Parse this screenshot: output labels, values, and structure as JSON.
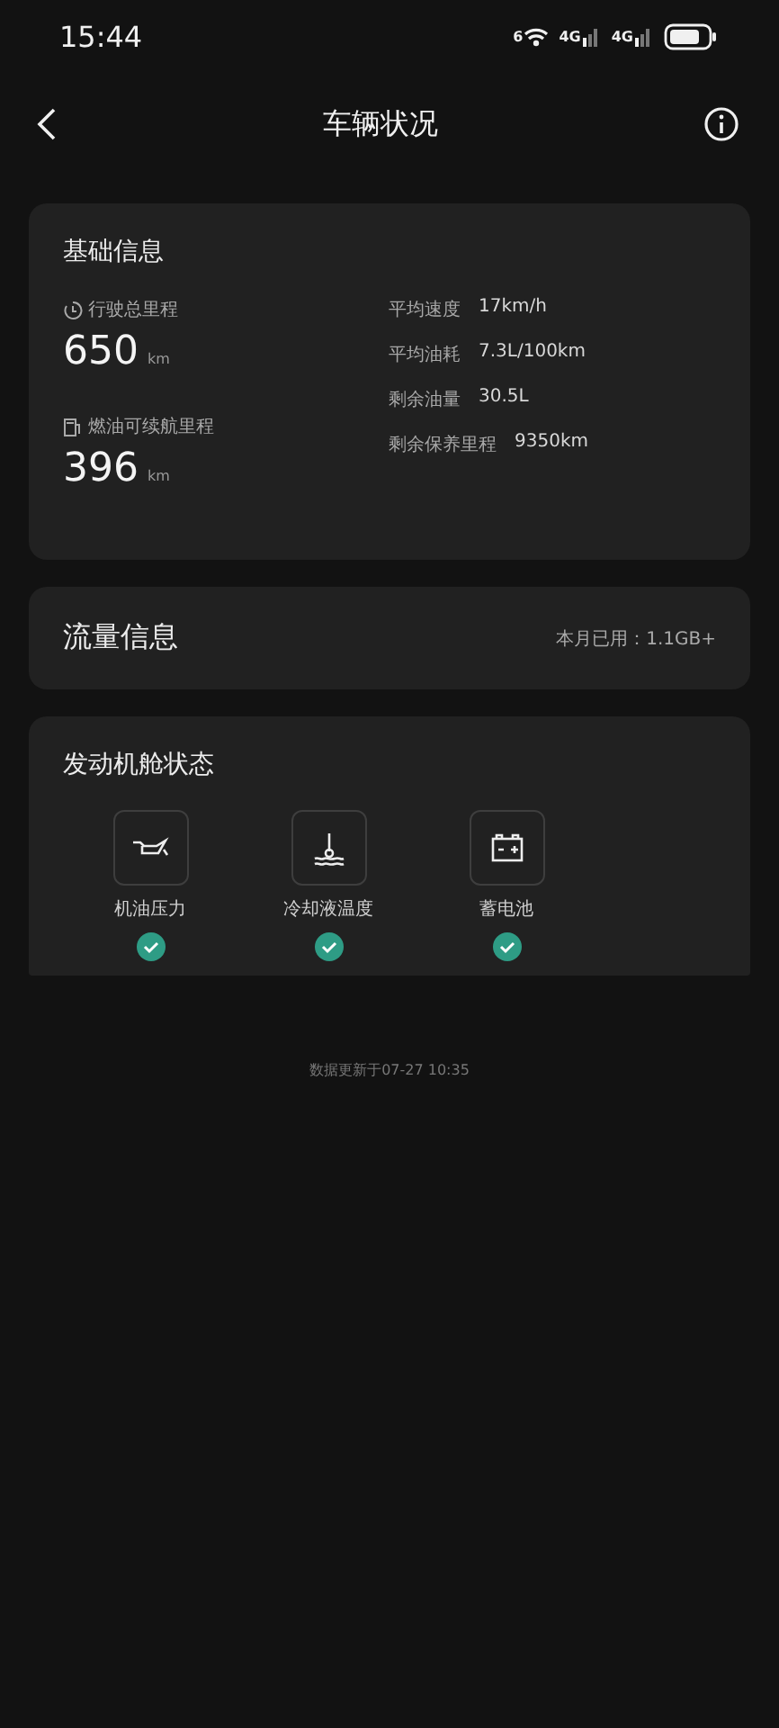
{
  "status_bar": {
    "time": "15:44",
    "wifi_badge": "6",
    "signals": [
      "4G",
      "4G"
    ]
  },
  "header": {
    "title": "车辆状况"
  },
  "basic_info": {
    "title": "基础信息",
    "big_stats": [
      {
        "kind": "clock",
        "label": "行驶总里程",
        "value": "650",
        "unit": "km"
      },
      {
        "kind": "fuel",
        "label": "燃油可续航里程",
        "value": "396",
        "unit": "km"
      }
    ],
    "details": [
      {
        "label": "平均速度",
        "value": "17km/h"
      },
      {
        "label": "平均油耗",
        "value": "7.3L/100km"
      },
      {
        "label": "剩余油量",
        "value": "30.5L"
      },
      {
        "label": "剩余保养里程",
        "value": "9350km"
      }
    ]
  },
  "data_usage": {
    "title": "流量信息",
    "summary": "本月已用：1.1GB+"
  },
  "engine_status": {
    "title": "发动机舱状态",
    "items": [
      {
        "kind": "oil",
        "label": "机油压力",
        "ok": true
      },
      {
        "kind": "coolant",
        "label": "冷却液温度",
        "ok": true
      },
      {
        "kind": "battery",
        "label": "蓄电池",
        "ok": true
      }
    ]
  },
  "footer": "数据更新于07-27 10:35"
}
